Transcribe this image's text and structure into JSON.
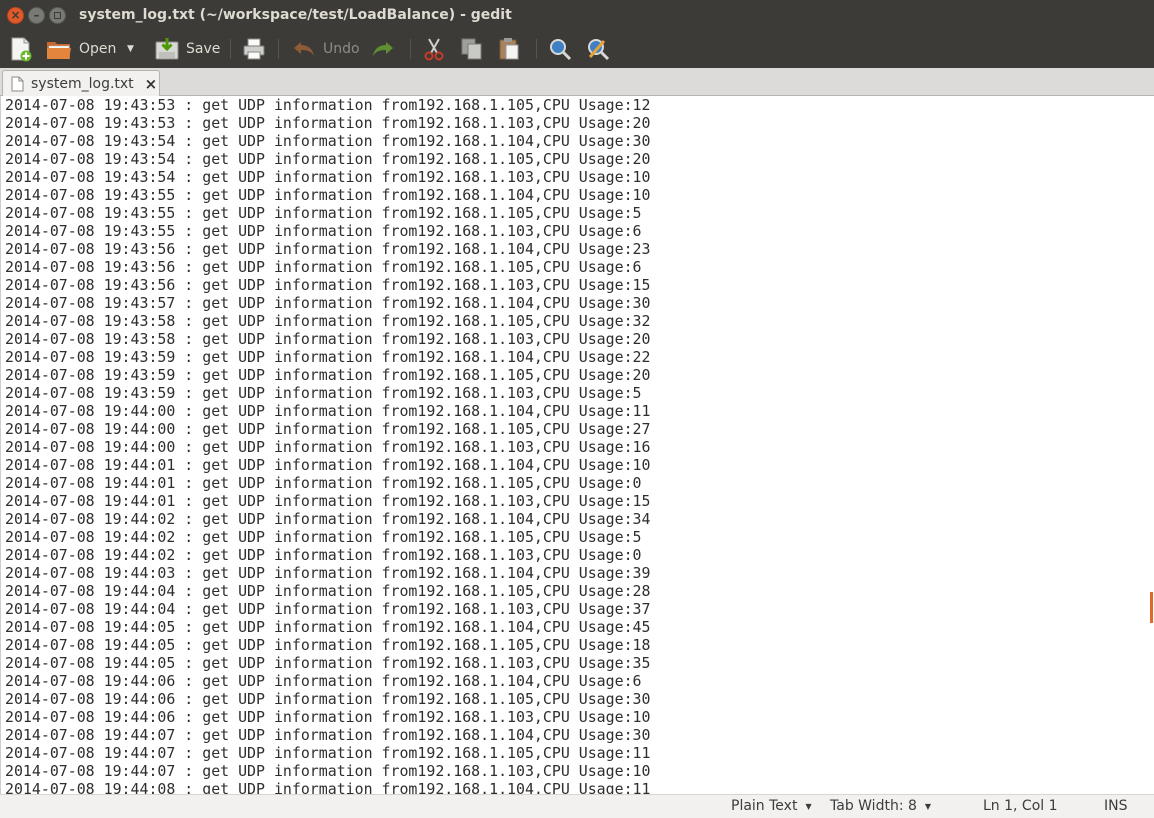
{
  "window": {
    "title": "system_log.txt (~/workspace/test/LoadBalance) - gedit"
  },
  "toolbar": {
    "open_label": "Open",
    "save_label": "Save",
    "undo_label": "Undo"
  },
  "tab": {
    "label": "system_log.txt",
    "close_glyph": "×"
  },
  "editor": {
    "lines": [
      "2014-07-08 19:43:53 : get UDP information from192.168.1.105,CPU Usage:12",
      "2014-07-08 19:43:53 : get UDP information from192.168.1.103,CPU Usage:20",
      "2014-07-08 19:43:54 : get UDP information from192.168.1.104,CPU Usage:30",
      "2014-07-08 19:43:54 : get UDP information from192.168.1.105,CPU Usage:20",
      "2014-07-08 19:43:54 : get UDP information from192.168.1.103,CPU Usage:10",
      "2014-07-08 19:43:55 : get UDP information from192.168.1.104,CPU Usage:10",
      "2014-07-08 19:43:55 : get UDP information from192.168.1.105,CPU Usage:5",
      "2014-07-08 19:43:55 : get UDP information from192.168.1.103,CPU Usage:6",
      "2014-07-08 19:43:56 : get UDP information from192.168.1.104,CPU Usage:23",
      "2014-07-08 19:43:56 : get UDP information from192.168.1.105,CPU Usage:6",
      "2014-07-08 19:43:56 : get UDP information from192.168.1.103,CPU Usage:15",
      "2014-07-08 19:43:57 : get UDP information from192.168.1.104,CPU Usage:30",
      "2014-07-08 19:43:58 : get UDP information from192.168.1.105,CPU Usage:32",
      "2014-07-08 19:43:58 : get UDP information from192.168.1.103,CPU Usage:20",
      "2014-07-08 19:43:59 : get UDP information from192.168.1.104,CPU Usage:22",
      "2014-07-08 19:43:59 : get UDP information from192.168.1.105,CPU Usage:20",
      "2014-07-08 19:43:59 : get UDP information from192.168.1.103,CPU Usage:5",
      "2014-07-08 19:44:00 : get UDP information from192.168.1.104,CPU Usage:11",
      "2014-07-08 19:44:00 : get UDP information from192.168.1.105,CPU Usage:27",
      "2014-07-08 19:44:00 : get UDP information from192.168.1.103,CPU Usage:16",
      "2014-07-08 19:44:01 : get UDP information from192.168.1.104,CPU Usage:10",
      "2014-07-08 19:44:01 : get UDP information from192.168.1.105,CPU Usage:0",
      "2014-07-08 19:44:01 : get UDP information from192.168.1.103,CPU Usage:15",
      "2014-07-08 19:44:02 : get UDP information from192.168.1.104,CPU Usage:34",
      "2014-07-08 19:44:02 : get UDP information from192.168.1.105,CPU Usage:5",
      "2014-07-08 19:44:02 : get UDP information from192.168.1.103,CPU Usage:0",
      "2014-07-08 19:44:03 : get UDP information from192.168.1.104,CPU Usage:39",
      "2014-07-08 19:44:04 : get UDP information from192.168.1.105,CPU Usage:28",
      "2014-07-08 19:44:04 : get UDP information from192.168.1.103,CPU Usage:37",
      "2014-07-08 19:44:05 : get UDP information from192.168.1.104,CPU Usage:45",
      "2014-07-08 19:44:05 : get UDP information from192.168.1.105,CPU Usage:18",
      "2014-07-08 19:44:05 : get UDP information from192.168.1.103,CPU Usage:35",
      "2014-07-08 19:44:06 : get UDP information from192.168.1.104,CPU Usage:6",
      "2014-07-08 19:44:06 : get UDP information from192.168.1.105,CPU Usage:30",
      "2014-07-08 19:44:06 : get UDP information from192.168.1.103,CPU Usage:10",
      "2014-07-08 19:44:07 : get UDP information from192.168.1.104,CPU Usage:30",
      "2014-07-08 19:44:07 : get UDP information from192.168.1.105,CPU Usage:11",
      "2014-07-08 19:44:07 : get UDP information from192.168.1.103,CPU Usage:10",
      "2014-07-08 19:44:08 : get UDP information from192.168.1.104,CPU Usage:11"
    ]
  },
  "statusbar": {
    "language": "Plain Text",
    "tab_width": "Tab Width: 8",
    "position": "Ln 1, Col 1",
    "mode": "INS"
  },
  "icons": {
    "new": "new-document-icon",
    "open": "open-folder-icon",
    "save": "save-icon",
    "print": "print-icon",
    "undo": "undo-icon",
    "redo": "redo-icon",
    "cut": "cut-icon",
    "copy": "copy-icon",
    "paste": "paste-icon",
    "find": "search-icon",
    "replace": "find-replace-icon"
  },
  "colors": {
    "accent_orange": "#e05a2b",
    "toolbar_bg": "#3c3b37"
  }
}
